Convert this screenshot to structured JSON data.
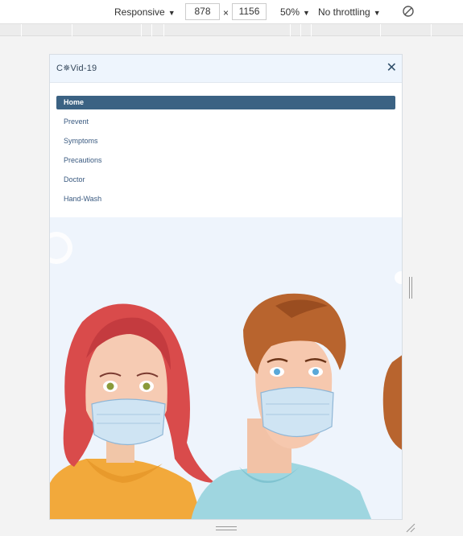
{
  "devtools": {
    "device": "Responsive",
    "width": "878",
    "times": "×",
    "height": "1156",
    "zoom": "50%",
    "throttling": "No throttling"
  },
  "page": {
    "brand": "C✵Vid-19",
    "close": "✕",
    "menu": [
      {
        "label": "Home",
        "active": true
      },
      {
        "label": "Prevent"
      },
      {
        "label": "Symptoms"
      },
      {
        "label": "Precautions"
      },
      {
        "label": "Doctor"
      },
      {
        "label": "Hand-Wash"
      }
    ]
  }
}
